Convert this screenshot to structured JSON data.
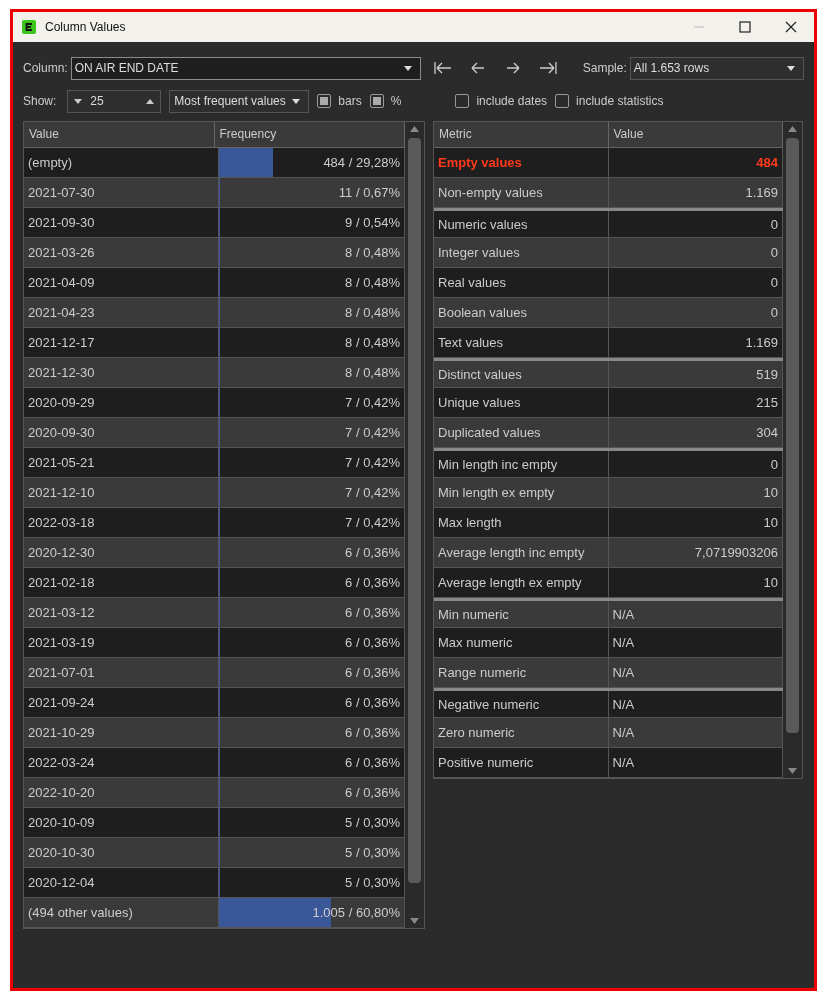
{
  "window": {
    "title": "Column Values"
  },
  "toolbar": {
    "column_label": "Column:",
    "column_value": "ON AIR END DATE",
    "sample_label": "Sample:",
    "sample_value": "All 1.653 rows",
    "show_label": "Show:",
    "show_value": "25",
    "mode_value": "Most frequent values",
    "display_toggles": [
      {
        "label": "bars",
        "checked": true
      },
      {
        "label": "%",
        "checked": true
      }
    ],
    "include_toggles": [
      {
        "label": "include dates",
        "checked": false
      },
      {
        "label": "include statistics",
        "checked": false
      }
    ]
  },
  "frequency_table": {
    "columns": [
      "Value",
      "Frequency"
    ],
    "rows": [
      {
        "value": "(empty)",
        "frequency": "484 / 29,28%",
        "level": 0.2928
      },
      {
        "value": "2021-07-30",
        "frequency": "11 /  0,67%",
        "level": 0.0067
      },
      {
        "value": "2021-09-30",
        "frequency": "9 /  0,54%",
        "level": 0.0054
      },
      {
        "value": "2021-03-26",
        "frequency": "8 /  0,48%",
        "level": 0.0048
      },
      {
        "value": "2021-04-09",
        "frequency": "8 /  0,48%",
        "level": 0.0048
      },
      {
        "value": "2021-04-23",
        "frequency": "8 /  0,48%",
        "level": 0.0048
      },
      {
        "value": "2021-12-17",
        "frequency": "8 /  0,48%",
        "level": 0.0048
      },
      {
        "value": "2021-12-30",
        "frequency": "8 /  0,48%",
        "level": 0.0048
      },
      {
        "value": "2020-09-29",
        "frequency": "7 /  0,42%",
        "level": 0.0042
      },
      {
        "value": "2020-09-30",
        "frequency": "7 /  0,42%",
        "level": 0.0042
      },
      {
        "value": "2021-05-21",
        "frequency": "7 /  0,42%",
        "level": 0.0042
      },
      {
        "value": "2021-12-10",
        "frequency": "7 /  0,42%",
        "level": 0.0042
      },
      {
        "value": "2022-03-18",
        "frequency": "7 /  0,42%",
        "level": 0.0042
      },
      {
        "value": "2020-12-30",
        "frequency": "6 /  0,36%",
        "level": 0.0036
      },
      {
        "value": "2021-02-18",
        "frequency": "6 /  0,36%",
        "level": 0.0036
      },
      {
        "value": "2021-03-12",
        "frequency": "6 /  0,36%",
        "level": 0.0036
      },
      {
        "value": "2021-03-19",
        "frequency": "6 /  0,36%",
        "level": 0.0036
      },
      {
        "value": "2021-07-01",
        "frequency": "6 /  0,36%",
        "level": 0.0036
      },
      {
        "value": "2021-09-24",
        "frequency": "6 /  0,36%",
        "level": 0.0036
      },
      {
        "value": "2021-10-29",
        "frequency": "6 /  0,36%",
        "level": 0.0036
      },
      {
        "value": "2022-03-24",
        "frequency": "6 /  0,36%",
        "level": 0.0036
      },
      {
        "value": "2022-10-20",
        "frequency": "6 /  0,36%",
        "level": 0.0036
      },
      {
        "value": "2020-10-09",
        "frequency": "5 /  0,30%",
        "level": 0.003
      },
      {
        "value": "2020-10-30",
        "frequency": "5 /  0,30%",
        "level": 0.003
      },
      {
        "value": "2020-12-04",
        "frequency": "5 /  0,30%",
        "level": 0.003
      },
      {
        "value": "(494 other values)",
        "frequency": "1.005 / 60,80%",
        "level": 0.608
      }
    ]
  },
  "metrics_table": {
    "columns": [
      "Metric",
      "Value"
    ],
    "groups": [
      [
        {
          "metric": "Empty values",
          "value": "484",
          "highlighted": true,
          "kind": "number"
        },
        {
          "metric": "Non-empty values",
          "value": "1.169",
          "highlighted": false,
          "kind": "number"
        }
      ],
      [
        {
          "metric": "Numeric values",
          "value": "0",
          "highlighted": false,
          "kind": "number"
        },
        {
          "metric": "Integer values",
          "value": "0",
          "highlighted": false,
          "kind": "number"
        },
        {
          "metric": "Real values",
          "value": "0",
          "highlighted": false,
          "kind": "number"
        },
        {
          "metric": "Boolean values",
          "value": "0",
          "highlighted": false,
          "kind": "number"
        },
        {
          "metric": "Text values",
          "value": "1.169",
          "highlighted": false,
          "kind": "number"
        }
      ],
      [
        {
          "metric": "Distinct values",
          "value": "519",
          "highlighted": false,
          "kind": "number"
        },
        {
          "metric": "Unique values",
          "value": "215",
          "highlighted": false,
          "kind": "number"
        },
        {
          "metric": "Duplicated values",
          "value": "304",
          "highlighted": false,
          "kind": "number"
        }
      ],
      [
        {
          "metric": "Min length inc empty",
          "value": "0",
          "highlighted": false,
          "kind": "number"
        },
        {
          "metric": "Min length ex empty",
          "value": "10",
          "highlighted": false,
          "kind": "number"
        },
        {
          "metric": "Max length",
          "value": "10",
          "highlighted": false,
          "kind": "number"
        },
        {
          "metric": "Average length inc empty",
          "value": "7,0719903206",
          "highlighted": false,
          "kind": "number"
        },
        {
          "metric": "Average length ex empty",
          "value": "10",
          "highlighted": false,
          "kind": "number"
        }
      ],
      [
        {
          "metric": "Min numeric",
          "value": "N/A",
          "highlighted": false,
          "kind": "text"
        },
        {
          "metric": "Max numeric",
          "value": "N/A",
          "highlighted": false,
          "kind": "text"
        },
        {
          "metric": "Range numeric",
          "value": "N/A",
          "highlighted": false,
          "kind": "text"
        }
      ],
      [
        {
          "metric": "Negative numeric",
          "value": "N/A",
          "highlighted": false,
          "kind": "text"
        },
        {
          "metric": "Zero numeric",
          "value": "N/A",
          "highlighted": false,
          "kind": "text"
        },
        {
          "metric": "Positive numeric",
          "value": "N/A",
          "highlighted": false,
          "kind": "text"
        }
      ]
    ]
  }
}
